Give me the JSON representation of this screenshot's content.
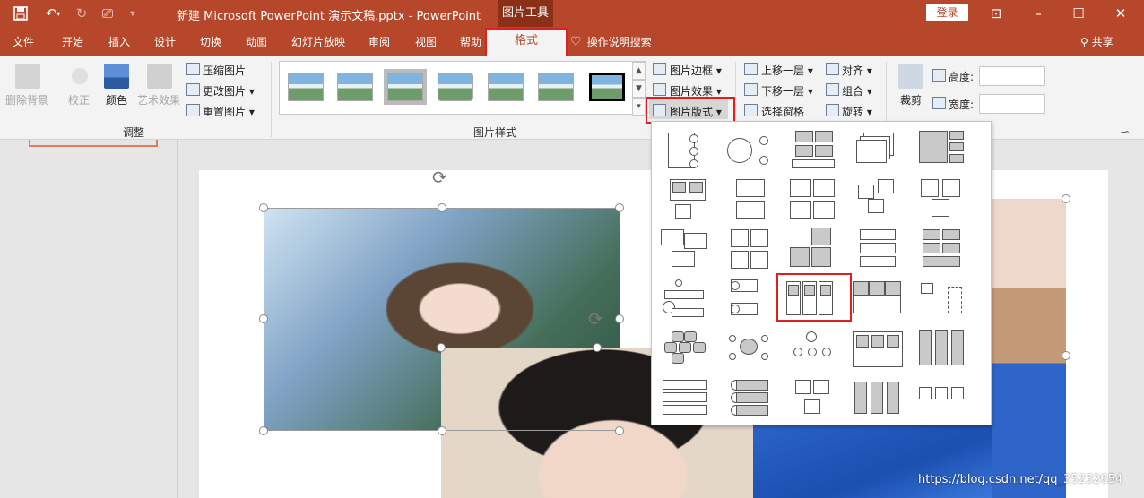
{
  "title_bar": {
    "document_title": "新建 Microsoft PowerPoint 演示文稿.pptx - PowerPoint",
    "context_tab_group": "图片工具",
    "login_label": "登录",
    "quick_access": [
      "save-icon",
      "undo-icon",
      "redo-icon",
      "start-from-beginning-icon",
      "customize-icon"
    ]
  },
  "tabs": [
    "文件",
    "开始",
    "插入",
    "设计",
    "切换",
    "动画",
    "幻灯片放映",
    "审阅",
    "视图",
    "帮助"
  ],
  "active_tab": "格式",
  "tell_me": "操作说明搜索",
  "share": "共享",
  "ribbon": {
    "adjust": {
      "remove_bg": "删除背景",
      "corrections": "校正",
      "color": "颜色",
      "artistic": "艺术效果",
      "compress": "压缩图片",
      "change": "更改图片",
      "reset": "重置图片",
      "group_label": "调整"
    },
    "styles": {
      "border": "图片边框",
      "effects": "图片效果",
      "layout": "图片版式",
      "group_label": "图片样式"
    },
    "arrange": {
      "bring_forward": "上移一层",
      "send_backward": "下移一层",
      "selection_pane": "选择窗格",
      "align": "对齐",
      "group": "组合",
      "rotate": "旋转"
    },
    "size": {
      "crop": "裁剪",
      "height_label": "高度:",
      "width_label": "宽度:",
      "height_value": "",
      "width_value": ""
    }
  },
  "watermark": "https://blog.csdn.net/qq_35232654",
  "colors": {
    "accent": "#b7472a",
    "highlight": "#e02020"
  }
}
